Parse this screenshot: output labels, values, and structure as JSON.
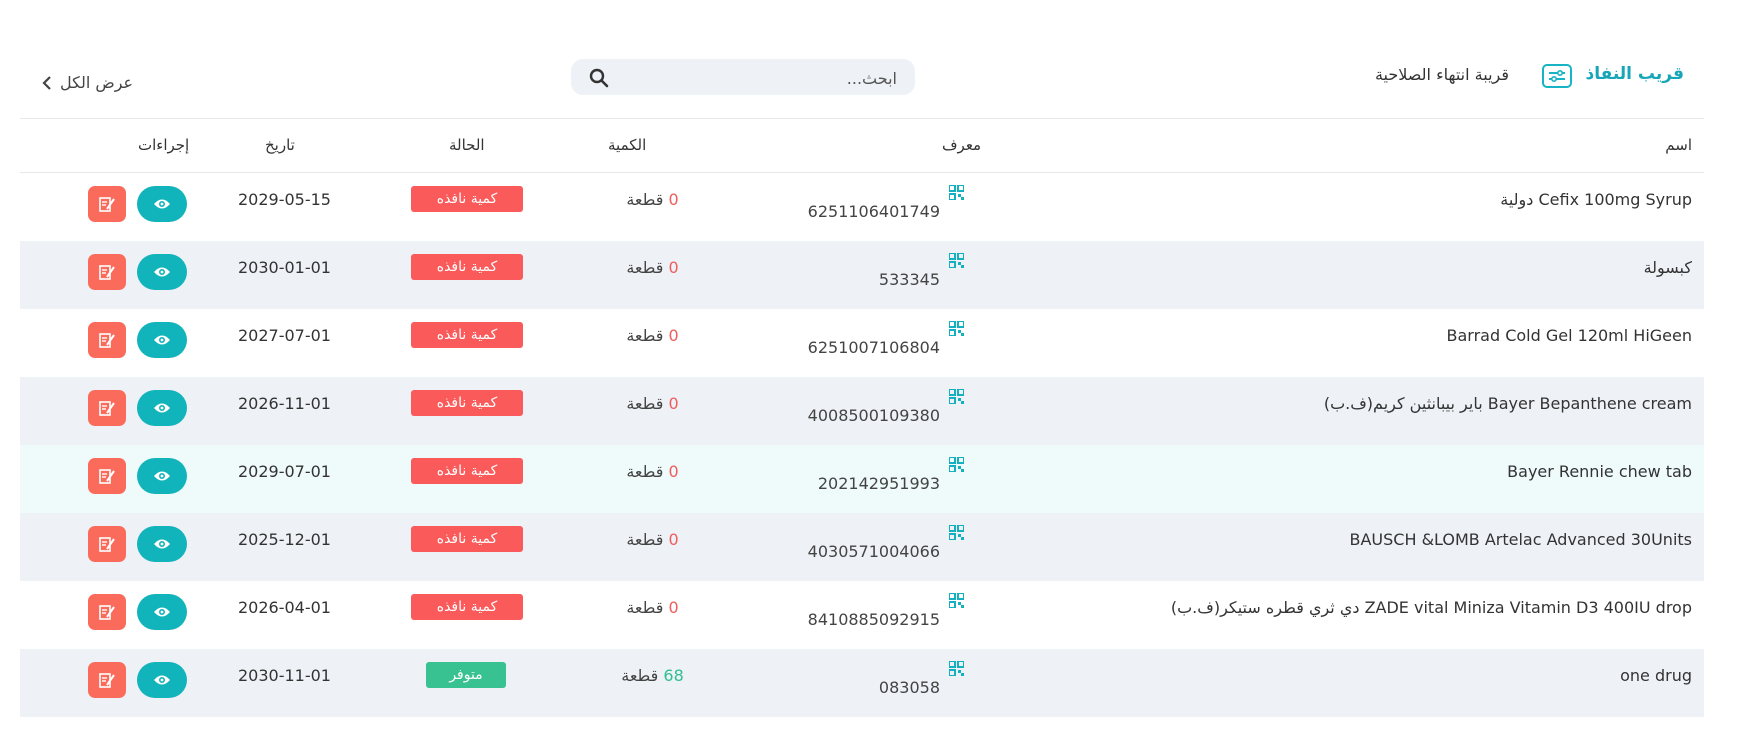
{
  "header": {
    "tab_active": "قريب النفاذ",
    "tab_inactive": "قريبة انتهاء الصلاحية",
    "filter_icon": "sliders-icon",
    "search_placeholder": "ابحث...",
    "view_all": "عرض الكل"
  },
  "table": {
    "columns": {
      "name": "اسم",
      "id": "معرف",
      "qty": "الكمية",
      "status": "الحالة",
      "date": "تاريخ",
      "actions": "إجراءات"
    },
    "unit": "قطعة",
    "rows": [
      {
        "name": "Cefix 100mg Syrup دولية",
        "id": "6251106401749",
        "qty": "0",
        "status": "كمية نافذه",
        "status_type": "out",
        "date": "2029-05-15"
      },
      {
        "name": "كبسولة",
        "id": "533345",
        "qty": "0",
        "status": "كمية نافذه",
        "status_type": "out",
        "date": "2030-01-01"
      },
      {
        "name": "Barrad Cold Gel 120ml HiGeen",
        "id": "6251007106804",
        "qty": "0",
        "status": "كمية نافذه",
        "status_type": "out",
        "date": "2027-07-01"
      },
      {
        "name": "Bayer Bepanthene cream باير بيبانثين كريم(ف.ب)",
        "id": "4008500109380",
        "qty": "0",
        "status": "كمية نافذه",
        "status_type": "out",
        "date": "2026-11-01"
      },
      {
        "name": "Bayer Rennie chew tab",
        "id": "202142951993",
        "qty": "0",
        "status": "كمية نافذه",
        "status_type": "out",
        "date": "2029-07-01"
      },
      {
        "name": "BAUSCH &LOMB Artelac Advanced 30Units",
        "id": "4030571004066",
        "qty": "0",
        "status": "كمية نافذه",
        "status_type": "out",
        "date": "2025-12-01"
      },
      {
        "name": "ZADE vital Miniza Vitamin D3 400IU drop دي ثري قطره ستيكر(ف.ب)",
        "id": "8410885092915",
        "qty": "0",
        "status": "كمية نافذه",
        "status_type": "out",
        "date": "2026-04-01"
      },
      {
        "name": "one drug",
        "id": "083058",
        "qty": "68",
        "status": "متوفر",
        "status_type": "ok",
        "date": "2030-11-01"
      }
    ]
  },
  "colors": {
    "accent": "#17a6b8",
    "danger": "#fb5a5a",
    "success": "#38c291",
    "view_button": "#12b4bb",
    "edit_button": "#fb6b5c"
  }
}
